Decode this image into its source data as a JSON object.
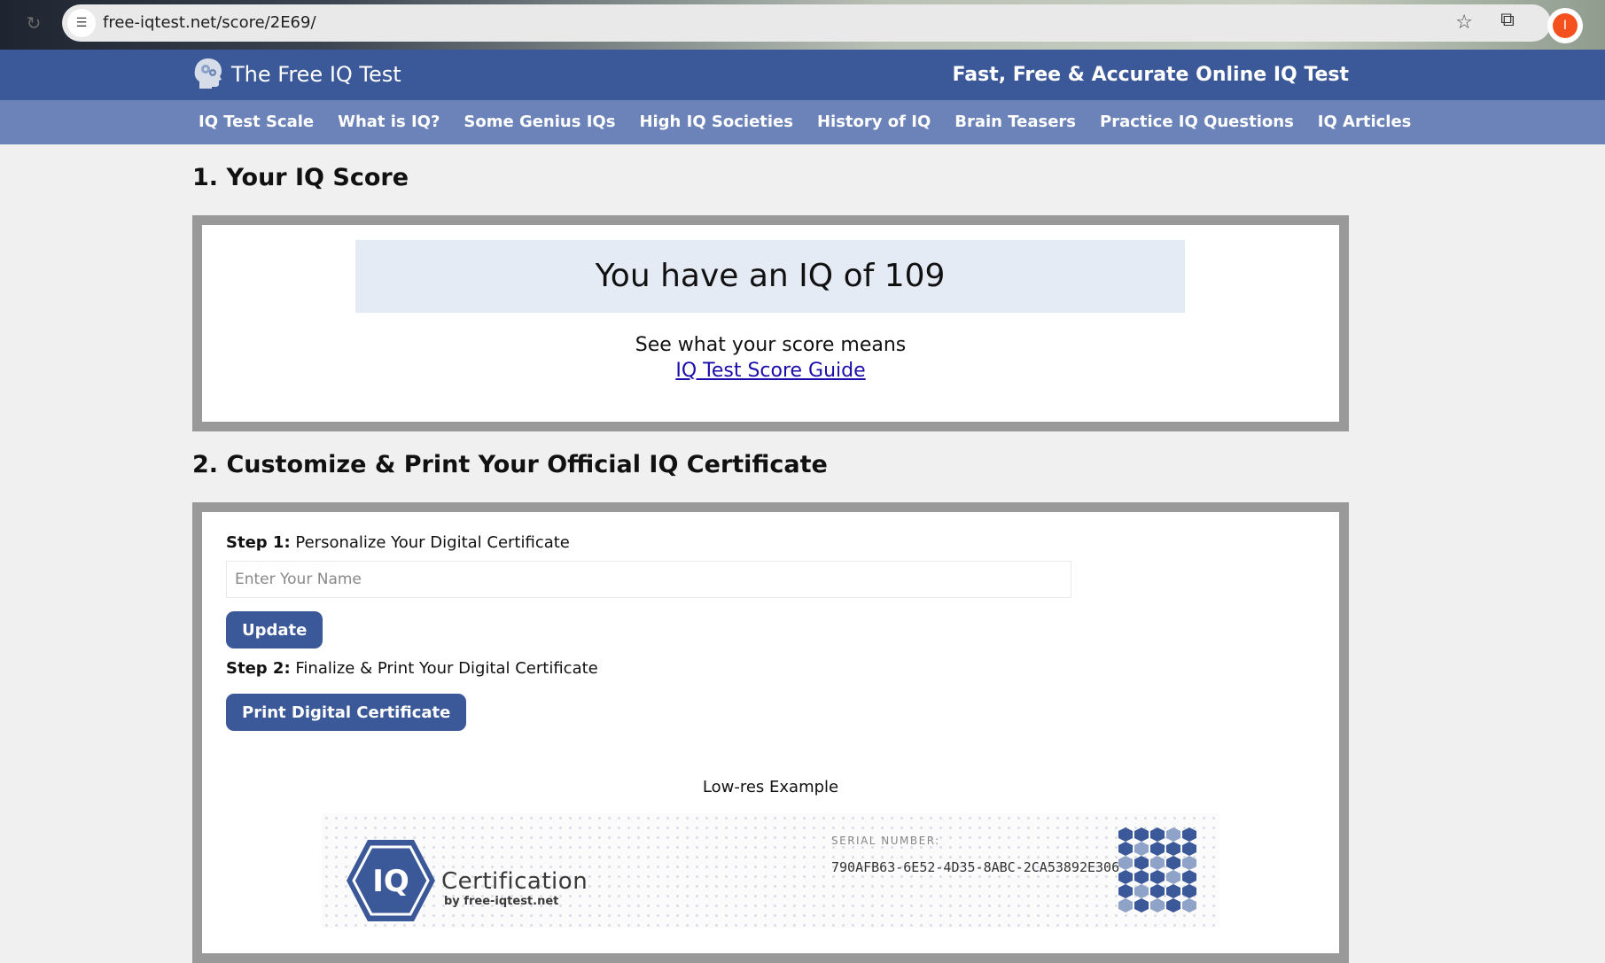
{
  "browser": {
    "url": "free-iqtest.net/score/2E69/",
    "profile_initial": "I"
  },
  "header": {
    "site_title": "The Free IQ Test",
    "tagline": "Fast, Free & Accurate Online IQ Test",
    "color": "#3b5998"
  },
  "nav": {
    "items": [
      {
        "label": "IQ Test Scale"
      },
      {
        "label": "What is IQ?"
      },
      {
        "label": "Some Genius IQs"
      },
      {
        "label": "High IQ Societies"
      },
      {
        "label": "History of IQ"
      },
      {
        "label": "Brain Teasers"
      },
      {
        "label": "Practice IQ Questions"
      },
      {
        "label": "IQ Articles"
      }
    ]
  },
  "score_section": {
    "heading": "1. Your IQ Score",
    "score_text": "You have an IQ of 109",
    "score_value": 109,
    "means_text": "See what your score means",
    "guide_link": "IQ Test Score Guide"
  },
  "certificate_section": {
    "heading": "2. Customize & Print Your Official IQ Certificate",
    "step1_prefix": "Step 1:",
    "step1_text": " Personalize Your Digital Certificate",
    "name_placeholder": "Enter Your Name",
    "name_value": "",
    "update_button": "Update",
    "step2_prefix": "Step 2:",
    "step2_text": " Finalize & Print Your Digital Certificate",
    "print_button": "Print Digital Certificate",
    "example_caption": "Low-res Example",
    "preview": {
      "badge_text": "IQ",
      "brand": "Certification",
      "by_line": "by free-iqtest.net",
      "serial_label": "SERIAL NUMBER:",
      "serial_value": "790AFB63-6E52-4D35-8ABC-2CA53892E306"
    }
  }
}
